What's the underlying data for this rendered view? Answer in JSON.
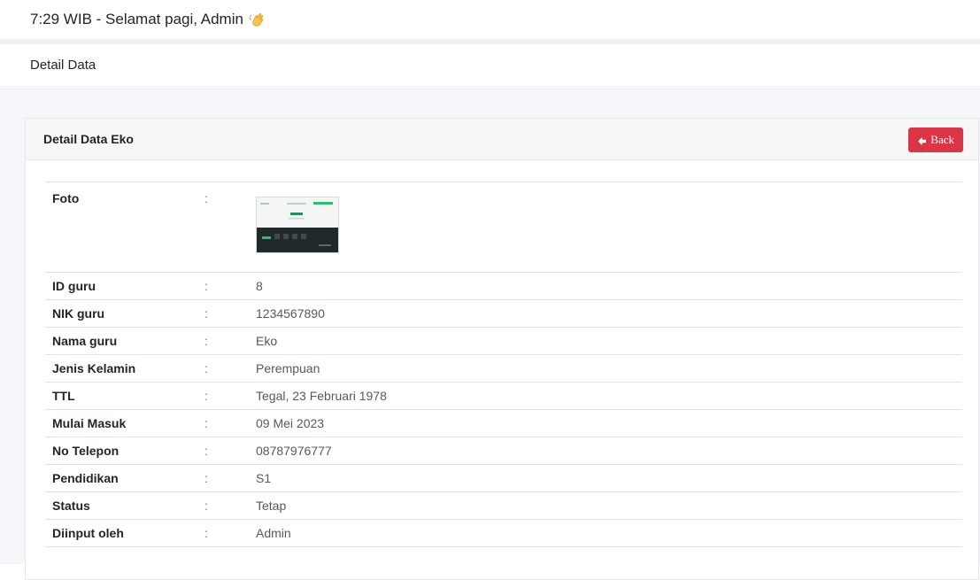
{
  "header": {
    "greeting": "7:29 WIB - Selamat pagi, Admin"
  },
  "page": {
    "title": "Detail Data"
  },
  "card": {
    "title": "Detail Data Eko",
    "back_label": "Back"
  },
  "details": {
    "foto_label": "Foto",
    "separator": ":",
    "rows": [
      {
        "label": "ID guru",
        "value": "8"
      },
      {
        "label": "NIK guru",
        "value": "1234567890"
      },
      {
        "label": "Nama guru",
        "value": "Eko"
      },
      {
        "label": "Jenis Kelamin",
        "value": "Perempuan"
      },
      {
        "label": "TTL",
        "value": "Tegal, 23 Februari 1978"
      },
      {
        "label": "Mulai Masuk",
        "value": "09 Mei 2023"
      },
      {
        "label": "No Telepon",
        "value": "08787976777"
      },
      {
        "label": "Pendidikan",
        "value": "S1"
      },
      {
        "label": "Status",
        "value": "Tetap"
      },
      {
        "label": "Diinput oleh",
        "value": "Admin"
      }
    ]
  },
  "colors": {
    "back_button": "#dc3545",
    "content_background": "#f4f6f9",
    "card_header": "#f7f7f7"
  },
  "icons": {
    "greeting": "waving-hand-icon",
    "back": "arrow-left-icon"
  }
}
